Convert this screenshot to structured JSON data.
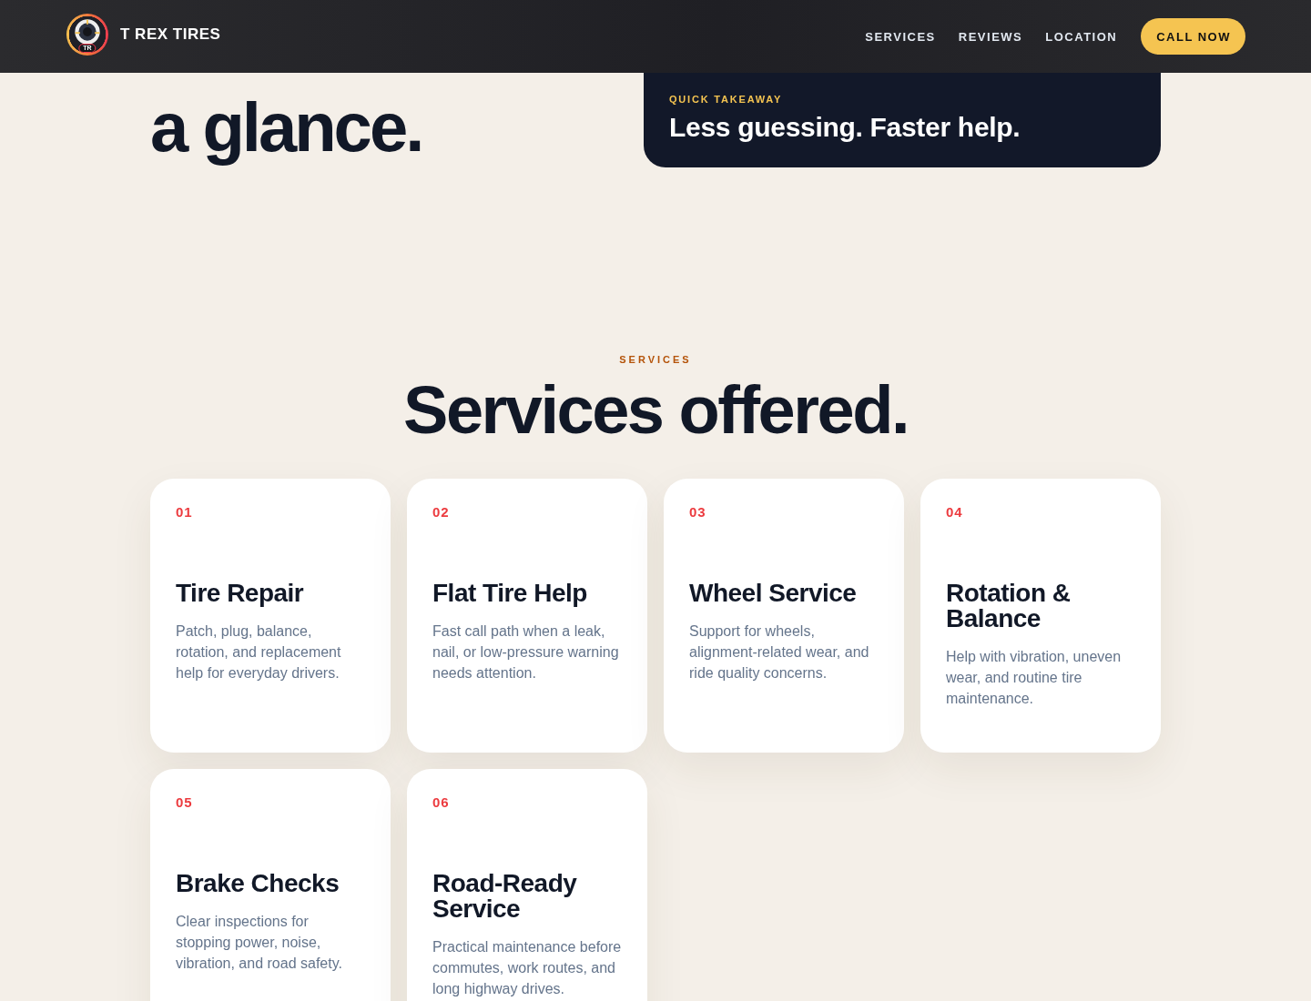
{
  "header": {
    "logo_initials": "TR",
    "brand": "T REX TIRES",
    "nav": [
      "SERVICES",
      "REVIEWS",
      "LOCATION"
    ],
    "cta": "CALL NOW"
  },
  "hero": {
    "heading": "a glance.",
    "takeaway": {
      "label": "QUICK TAKEAWAY",
      "title": "Less guessing. Faster help."
    }
  },
  "services": {
    "eyebrow": "SERVICES",
    "heading": "Services offered.",
    "cards": [
      {
        "number": "01",
        "title": "Tire Repair",
        "description": "Patch, plug, balance, rotation, and replacement help for everyday drivers."
      },
      {
        "number": "02",
        "title": "Flat Tire Help",
        "description": "Fast call path when a leak, nail, or low-pressure warning needs attention."
      },
      {
        "number": "03",
        "title": "Wheel Service",
        "description": "Support for wheels, alignment-related wear, and ride quality concerns."
      },
      {
        "number": "04",
        "title": "Rotation & Balance",
        "description": "Help with vibration, uneven wear, and routine tire maintenance."
      },
      {
        "number": "05",
        "title": "Brake Checks",
        "description": "Clear inspections for stopping power, noise, vibration, and road safety."
      },
      {
        "number": "06",
        "title": "Road-Ready Service",
        "description": "Practical maintenance before commutes, work routes, and long highway drives."
      }
    ]
  }
}
